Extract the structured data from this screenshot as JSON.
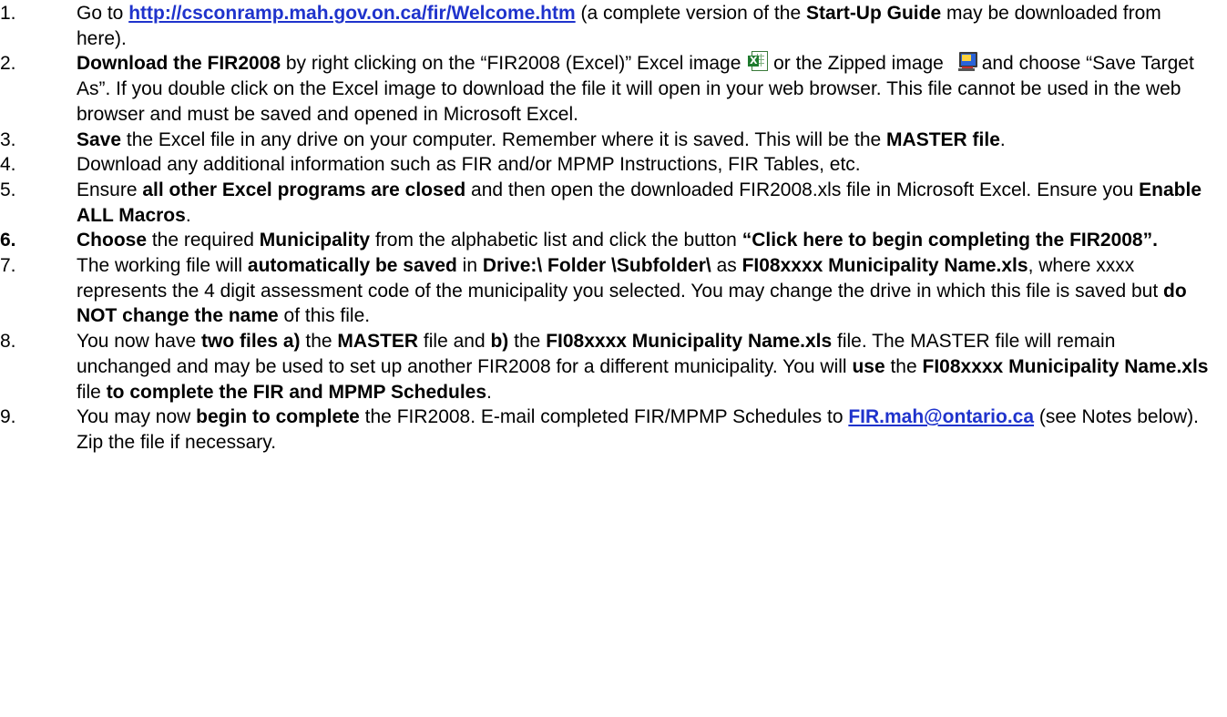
{
  "list": [
    {
      "number": "1.",
      "segments": [
        {
          "t": "Go to "
        },
        {
          "t": "http://csconramp.mah.gov.on.ca/fir/Welcome.htm",
          "link": true
        },
        {
          "t": "  (a complete version of the "
        },
        {
          "t": "Start-Up Guide",
          "b": true
        },
        {
          "t": " may be downloaded from here)."
        }
      ]
    },
    {
      "number": "2.",
      "segments": [
        {
          "t": "Download the FIR2008",
          "b": true
        },
        {
          "t": " by right clicking on the “FIR2008 (Excel)” Excel image "
        },
        {
          "icon": "excel-icon"
        },
        {
          "t": " or the Zipped image "
        },
        {
          "icon": "zip-icon"
        },
        {
          "t": "and choose “Save Target As”.  If you double click on the Excel image to download the file it will open in your web browser.  This file cannot be used in the web browser and must be saved and opened in Microsoft Excel."
        }
      ]
    },
    {
      "number": "3.",
      "segments": [
        {
          "t": "Save",
          "b": true
        },
        {
          "t": " the Excel file in any drive on your computer.  Remember where it is saved.  This will be the "
        },
        {
          "t": "MASTER file",
          "b": true
        },
        {
          "t": "."
        }
      ]
    },
    {
      "number": "4.",
      "segments": [
        {
          "t": "Download any additional information such as FIR and/or MPMP Instructions, FIR Tables, etc."
        }
      ]
    },
    {
      "number": "5.",
      "segments": [
        {
          "t": "Ensure "
        },
        {
          "t": "all other Excel programs are closed",
          "b": true
        },
        {
          "t": " and then open the downloaded FIR2008.xls file in Microsoft Excel.  Ensure you "
        },
        {
          "t": "Enable ALL Macros",
          "b": true
        },
        {
          "t": "."
        }
      ]
    },
    {
      "number": "6.",
      "number_bold": true,
      "segments": [
        {
          "t": "Choose",
          "b": true
        },
        {
          "t": " the required "
        },
        {
          "t": "Municipality",
          "b": true
        },
        {
          "t": " from the alphabetic list and click the button "
        },
        {
          "t": "“Click here to begin completing the FIR2008”.",
          "b": true
        }
      ]
    },
    {
      "number": "7.",
      "segments": [
        {
          "t": "The working file will "
        },
        {
          "t": "automatically be saved",
          "b": true
        },
        {
          "t": " in "
        },
        {
          "t": "Drive:\\ Folder \\Subfolder\\",
          "b": true
        },
        {
          "t": " as "
        },
        {
          "t": "FI08xxxx Municipality Name.xls",
          "b": true
        },
        {
          "t": ", where xxxx represents the 4 digit assessment code of the municipality you selected.  You may change the drive in which this file is saved but "
        },
        {
          "t": "do NOT change the name",
          "b": true
        },
        {
          "t": " of this file."
        }
      ]
    },
    {
      "number": "8.",
      "segments": [
        {
          "t": "You now have "
        },
        {
          "t": "two files a)",
          "b": true
        },
        {
          "t": " the "
        },
        {
          "t": "MASTER",
          "b": true
        },
        {
          "t": " file and "
        },
        {
          "t": "b)",
          "b": true
        },
        {
          "t": " the "
        },
        {
          "t": "FI08xxxx Municipality Name.xls",
          "b": true
        },
        {
          "t": " file.  The MASTER file will remain unchanged and may be used to set up another FIR2008 for a different municipality.  You will "
        },
        {
          "t": "use",
          "b": true
        },
        {
          "t": " the "
        },
        {
          "t": "FI08xxxx Municipality Name.xls",
          "b": true
        },
        {
          "t": " file "
        },
        {
          "t": "to complete the FIR and MPMP Schedules",
          "b": true
        },
        {
          "t": "."
        }
      ]
    },
    {
      "number": "9.",
      "segments": [
        {
          "t": "You may now "
        },
        {
          "t": "begin to complete",
          "b": true
        },
        {
          "t": " the FIR2008.  E-mail completed FIR/MPMP Schedules to "
        },
        {
          "t": "FIR.mah@ontario.ca",
          "link": true
        },
        {
          "t": "  (see Notes below).  Zip the file if necessary."
        }
      ]
    }
  ]
}
